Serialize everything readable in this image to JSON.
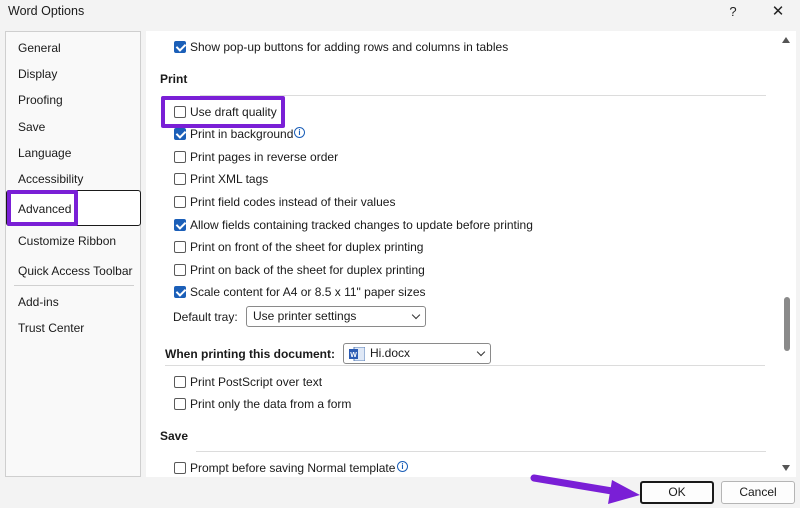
{
  "window": {
    "title": "Word Options",
    "help": "?",
    "close": "✕"
  },
  "sidebar": {
    "items": [
      {
        "label": "General"
      },
      {
        "label": "Display"
      },
      {
        "label": "Proofing"
      },
      {
        "label": "Save"
      },
      {
        "label": "Language"
      },
      {
        "label": "Accessibility"
      },
      {
        "label": "Advanced",
        "selected": true
      },
      {
        "label": "Customize Ribbon"
      },
      {
        "label": "Quick Access Toolbar"
      },
      {
        "label": "Add-ins"
      },
      {
        "label": "Trust Center"
      }
    ]
  },
  "content": {
    "top_option": {
      "label": "Show pop-up buttons for adding rows and columns in tables",
      "checked": true
    },
    "print": {
      "heading": "Print",
      "options": [
        {
          "label": "Use draft quality",
          "checked": false
        },
        {
          "label": "Print in background",
          "checked": true
        },
        {
          "label": "Print pages in reverse order",
          "checked": false
        },
        {
          "label": "Print XML tags",
          "checked": false
        },
        {
          "label": "Print field codes instead of their values",
          "checked": false
        },
        {
          "label": "Allow fields containing tracked changes to update before printing",
          "checked": true
        },
        {
          "label": "Print on front of the sheet for duplex printing",
          "checked": false
        },
        {
          "label": "Print on back of the sheet for duplex printing",
          "checked": false
        },
        {
          "label": "Scale content for A4 or 8.5 x 11\" paper sizes",
          "checked": true
        }
      ],
      "default_tray_label": "Default tray:",
      "default_tray_value": "Use printer settings"
    },
    "when_printing": {
      "heading": "When printing this document:",
      "document": "Hi.docx",
      "options": [
        {
          "label": "Print PostScript over text",
          "checked": false
        },
        {
          "label": "Print only the data from a form",
          "checked": false
        }
      ]
    },
    "save": {
      "heading": "Save",
      "options": [
        {
          "label": "Prompt before saving Normal template",
          "checked": false
        }
      ]
    }
  },
  "footer": {
    "ok_label": "OK",
    "cancel_label": "Cancel"
  },
  "colors": {
    "highlight": "#7a1fd6",
    "checkbox_checked": "#1b5fb8"
  }
}
